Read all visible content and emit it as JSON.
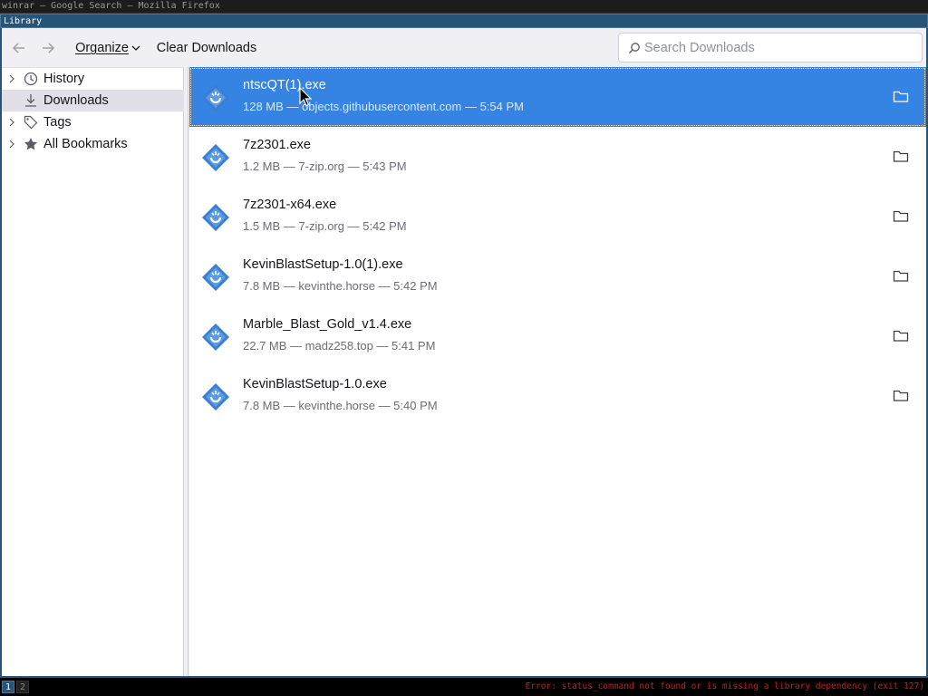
{
  "os": {
    "title": "winrar — Google Search — Mozilla Firefox",
    "workspaces": [
      "1",
      "2"
    ],
    "status_error": "Error: status_command not found or is missing a library dependency (exit 127)"
  },
  "window": {
    "title": "Library"
  },
  "toolbar": {
    "organize_label": "Organize",
    "clear_label": "Clear Downloads",
    "search_placeholder": "Search Downloads"
  },
  "sidebar": {
    "items": [
      {
        "label": "History",
        "icon": "clock-icon",
        "expandable": true,
        "selected": false
      },
      {
        "label": "Downloads",
        "icon": "download-icon",
        "expandable": false,
        "selected": true
      },
      {
        "label": "Tags",
        "icon": "tag-icon",
        "expandable": true,
        "selected": false
      },
      {
        "label": "All Bookmarks",
        "icon": "star-icon",
        "expandable": true,
        "selected": false
      }
    ]
  },
  "downloads": [
    {
      "name": "ntscQT(1).exe",
      "meta": "128 MB — objects.githubusercontent.com — 5:54 PM",
      "selected": true
    },
    {
      "name": "7z2301.exe",
      "meta": "1.2 MB — 7-zip.org — 5:43 PM",
      "selected": false
    },
    {
      "name": "7z2301-x64.exe",
      "meta": "1.5 MB — 7-zip.org — 5:42 PM",
      "selected": false
    },
    {
      "name": "KevinBlastSetup-1.0(1).exe",
      "meta": "7.8 MB — kevinthe.horse — 5:42 PM",
      "selected": false
    },
    {
      "name": "Marble_Blast_Gold_v1.4.exe",
      "meta": "22.7 MB — madz258.top — 5:41 PM",
      "selected": false
    },
    {
      "name": "KevinBlastSetup-1.0.exe",
      "meta": "7.8 MB — kevinthe.horse — 5:40 PM",
      "selected": false
    }
  ],
  "colors": {
    "accent": "#3584e4",
    "window_border": "#285577",
    "status_error": "#c71e1e"
  }
}
